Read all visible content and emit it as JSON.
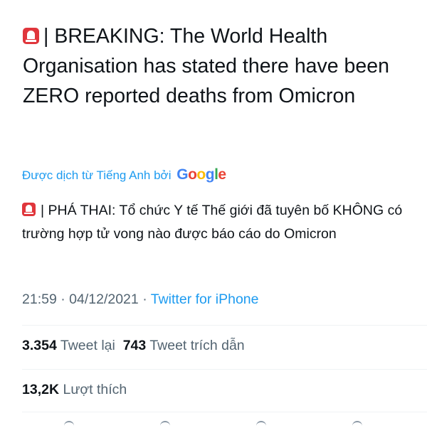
{
  "tweet": {
    "text": "| BREAKING: The World Health Organisation has stated there have been ZERO reported deaths from Omicron",
    "emoji_icon": "police-car-light-icon"
  },
  "translation": {
    "label": "Được dịch từ Tiếng Anh bởi",
    "provider": {
      "letters": [
        "G",
        "o",
        "o",
        "g",
        "l",
        "e"
      ],
      "colors": [
        "#4285f4",
        "#ea4335",
        "#fbbc05",
        "#4285f4",
        "#34a853",
        "#ea4335"
      ]
    },
    "text": "| PHÁ THAI: Tổ chức Y tế Thế giới đã tuyên bố KHÔNG có trường hợp tử vong nào được báo cáo do Omicron"
  },
  "meta": {
    "time": "21:59",
    "sep1": "·",
    "date": "04/12/2021",
    "sep2": "·",
    "source": "Twitter for iPhone"
  },
  "stats": {
    "retweets_count": "3.354",
    "retweets_label": "Tweet lại",
    "quotes_count": "743",
    "quotes_label": "Tweet trích dẫn",
    "likes_count": "13,2K",
    "likes_label": "Lượt thích"
  },
  "colors": {
    "text": "#0f1419",
    "secondary": "#536471",
    "accent": "#1d9bf0"
  }
}
